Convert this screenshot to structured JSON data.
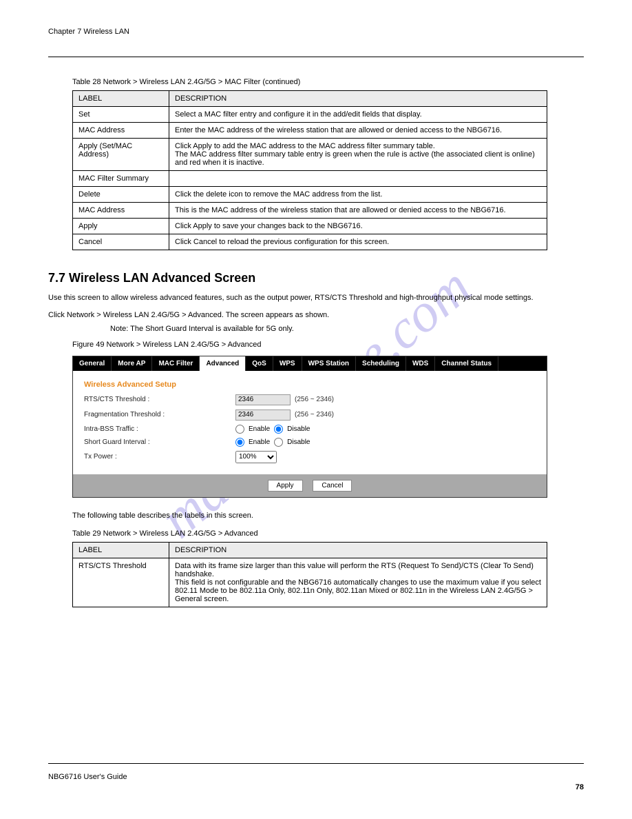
{
  "watermark": "manualshive.com",
  "header": {
    "chapter": "Chapter 7 Wireless LAN",
    "right": "NBG6716 User's Guide",
    "page_top": "78"
  },
  "footer": {
    "left": "NBG6716 User's Guide",
    "page_bottom": "78"
  },
  "table1": {
    "caption": "Table 28   Network > Wireless LAN 2.4G/5G > MAC Filter (continued)",
    "header_left": "LABEL",
    "header_right": "DESCRIPTION",
    "rows": [
      {
        "label": "Set",
        "desc": "Select a MAC filter entry and configure it in the add/edit fields that display."
      },
      {
        "label": "MAC Address",
        "desc": "Enter the MAC address of the wireless station that are allowed or denied access to the NBG6716."
      },
      {
        "label": "Apply (Set/MAC Address)",
        "desc": "Click Apply to add the MAC address to the MAC address filter summary table.\nThe MAC address filter summary table entry is green when the rule is active (the associated client is online) and red when it is inactive."
      },
      {
        "label": "MAC Filter Summary",
        "desc": ""
      },
      {
        "label": "Delete",
        "desc": "Click the delete icon to remove the MAC address from the list."
      },
      {
        "label": "MAC Address",
        "desc": "This is the MAC address of the wireless station that are allowed or denied access to the NBG6716."
      },
      {
        "label": "Apply",
        "desc": "Click Apply to save your changes back to the NBG6716."
      },
      {
        "label": "Cancel",
        "desc": "Click Cancel to reload the previous configuration for this screen."
      }
    ]
  },
  "section": {
    "heading": "7.7  Wireless LAN Advanced Screen",
    "para": "Use this screen to allow wireless advanced features, such as the output power, RTS/CTS Threshold and high-throughput physical mode settings.",
    "nav": "Click Network > Wireless LAN 2.4G/5G > Advanced. The screen appears as shown.",
    "note": "Note: The Short Guard Interval is available for 5G only.",
    "fig_caption": "Figure 49   Network > Wireless LAN 2.4G/5G > Advanced"
  },
  "screenshot": {
    "tabs": [
      "General",
      "More AP",
      "MAC Filter",
      "Advanced",
      "QoS",
      "WPS",
      "WPS Station",
      "Scheduling",
      "WDS",
      "Channel Status"
    ],
    "active_tab_index": 3,
    "title": "Wireless Advanced Setup",
    "rows": {
      "rts_label": "RTS/CTS Threshold :",
      "rts_value": "2346",
      "rts_range": "(256 ~ 2346)",
      "frag_label": "Fragmentation Threshold :",
      "frag_value": "2346",
      "frag_range": "(256 ~ 2346)",
      "intra_label": "Intra-BSS Traffic :",
      "enable": "Enable",
      "disable": "Disable",
      "intra_checked": "disable",
      "sgi_label": "Short Guard Interval :",
      "sgi_checked": "enable",
      "txp_label": "Tx Power :",
      "txp_value": "100%"
    },
    "buttons": {
      "apply": "Apply",
      "cancel": "Cancel"
    }
  },
  "table2": {
    "intro": "The following table describes the labels in this screen.",
    "caption": "Table 29   Network > Wireless LAN 2.4G/5G > Advanced",
    "header_left": "LABEL",
    "header_right": "DESCRIPTION",
    "rows": [
      {
        "label": "RTS/CTS Threshold",
        "desc": "Data with its frame size larger than this value will perform the RTS (Request To Send)/CTS (Clear To Send) handshake.\nThis field is not configurable and the NBG6716 automatically changes to use the maximum value if you select 802.11 Mode to be 802.11a Only, 802.11n Only, 802.11an Mixed or 802.11n in the Wireless LAN 2.4G/5G > General screen."
      }
    ]
  }
}
